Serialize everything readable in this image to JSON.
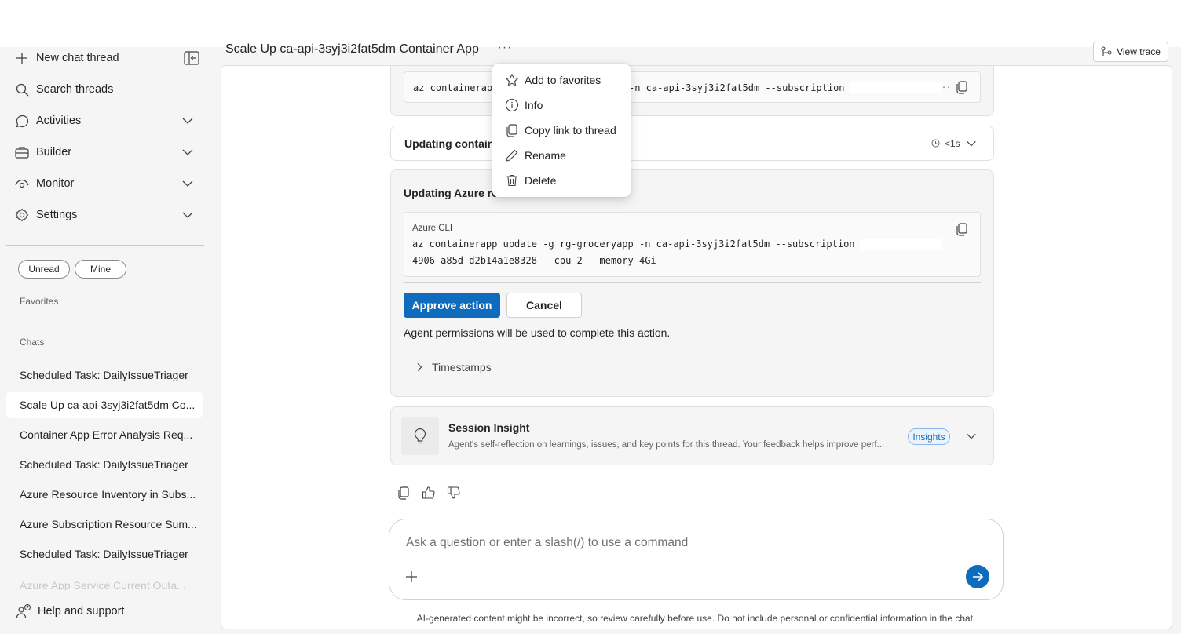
{
  "sidebar": {
    "new_chat": "New chat thread",
    "search": "Search threads",
    "nav": [
      {
        "label": "Activities"
      },
      {
        "label": "Builder"
      },
      {
        "label": "Monitor"
      },
      {
        "label": "Settings"
      }
    ],
    "filters": [
      "Unread",
      "Mine"
    ],
    "favorites_label": "Favorites",
    "chats_label": "Chats",
    "chats": [
      "Scheduled Task: DailyIssueTriager",
      "Scale Up ca-api-3syj3i2fat5dm Co...",
      "Container App Error Analysis Req...",
      "Scheduled Task: DailyIssueTriager",
      "Azure Resource Inventory in Subs...",
      "Azure Subscription Resource Sum...",
      "Scheduled Task: DailyIssueTriager",
      "Azure App Service Current Outa..."
    ],
    "help": "Help and support"
  },
  "header": {
    "title": "Scale Up ca-api-3syj3i2fat5dm Container App",
    "more": "···",
    "view_trace": "View trace"
  },
  "menu": {
    "items": [
      "Add to favorites",
      "Info",
      "Copy link to thread",
      "Rename",
      "Delete"
    ]
  },
  "main": {
    "prev_command_start": "az containerap",
    "prev_command_end": "-n ca-api-3syj3i2fat5dm --subscription",
    "prev_command_ellipsis": "..",
    "updating_container_title": "Updating containe",
    "updating_container_time": "<1s",
    "azure_card_title": "Updating Azure re",
    "cli_label": "Azure CLI",
    "cli_line1": "az containerapp update -g rg-groceryapp -n ca-api-3syj3i2fat5dm --subscription",
    "cli_line2": "4906-a85d-d2b14a1e8328 --cpu 2 --memory 4Gi",
    "approve": "Approve action",
    "cancel": "Cancel",
    "permission_note": "Agent permissions will be used to complete this action.",
    "timestamps": "Timestamps",
    "insight_title": "Session Insight",
    "insight_desc": "Agent's self-reflection on learnings, issues, and key points for this thread. Your feedback helps improve perf...",
    "insight_badge": "Insights"
  },
  "composer": {
    "placeholder": "Ask a question or enter a slash(/) to use a command",
    "disclaimer": "AI-generated content might be incorrect, so review carefully before use. Do not include personal or confidential information in the chat."
  },
  "colors": {
    "accent": "#0f6cbd",
    "sidebar_bg": "#f5f5f5",
    "card_bg": "#f5f5f5"
  }
}
